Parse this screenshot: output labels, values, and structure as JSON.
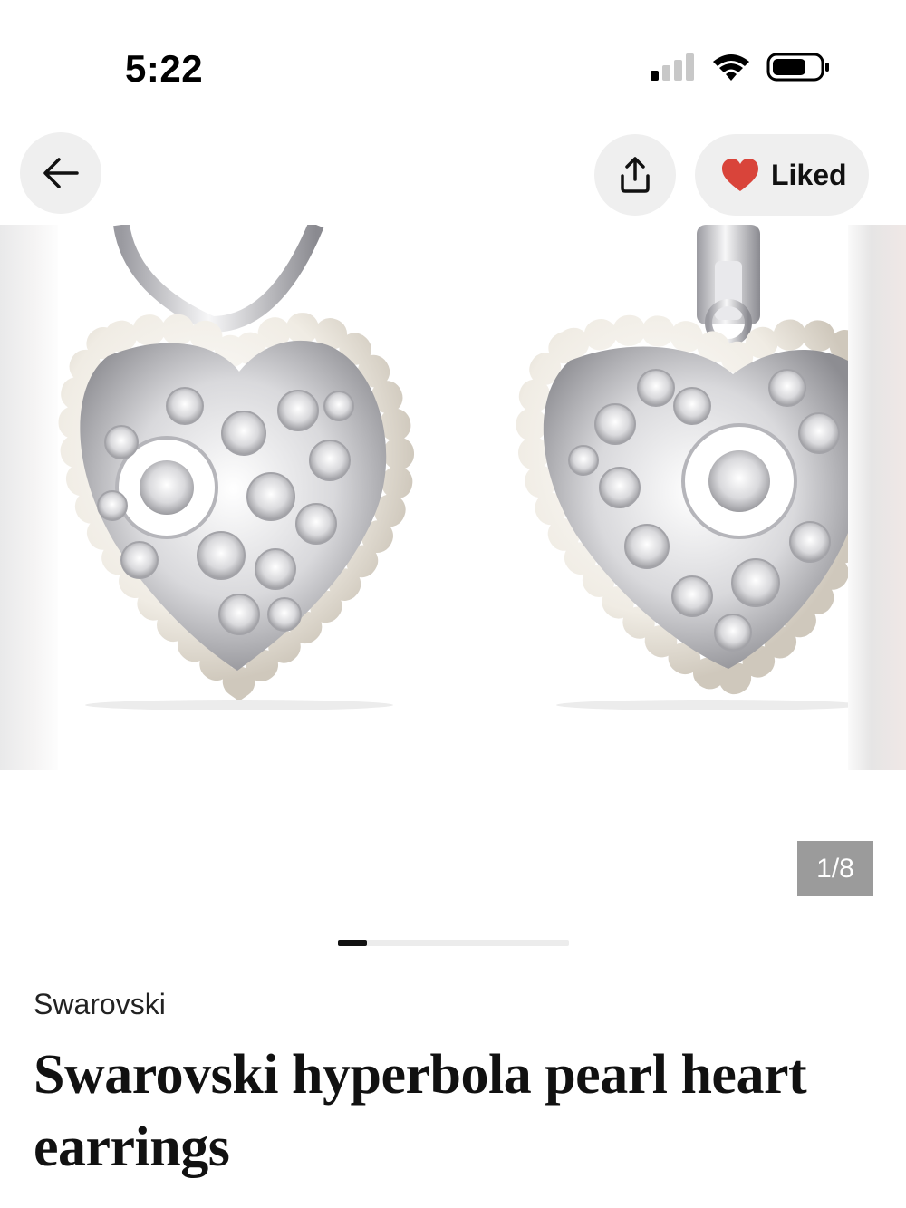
{
  "status_bar": {
    "time": "5:22",
    "icons": [
      "cellular-signal-icon",
      "wifi-icon",
      "battery-icon"
    ]
  },
  "toolbar": {
    "back_icon": "arrow-left-icon",
    "share_icon": "share-upload-icon",
    "liked_icon": "heart-filled-icon",
    "liked_label": "Liked"
  },
  "colors": {
    "heart": "#d9443a",
    "badge_bg": "#9b9b9b",
    "button_bg": "#efefef"
  },
  "carousel": {
    "image_alt": "Swarovski hyperbola pearl heart earrings",
    "current": 1,
    "total": 8,
    "counter_text": "1/8"
  },
  "product": {
    "brand": "Swarovski",
    "title": "Swarovski hyperbola pearl heart earrings"
  }
}
